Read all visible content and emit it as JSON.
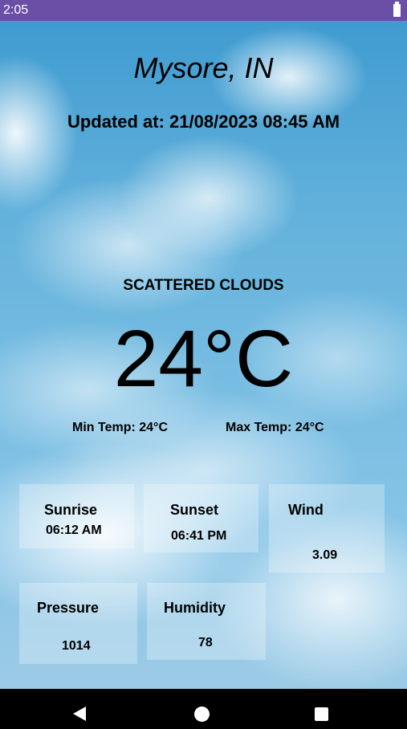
{
  "status_bar": {
    "time": "2:05",
    "battery_icon": "battery-full-icon"
  },
  "location": "Mysore, IN",
  "updated": "Updated at: 21/08/2023 08:45 AM",
  "weather": {
    "description": "SCATTERED CLOUDS",
    "temperature": "24°C",
    "min_temp": "Min Temp: 24°C",
    "max_temp": "Max Temp: 24°C"
  },
  "details": {
    "sunrise": {
      "label": "Sunrise",
      "value": "06:12 AM"
    },
    "sunset": {
      "label": "Sunset",
      "value": "06:41 PM"
    },
    "wind": {
      "label": "Wind",
      "value": "3.09"
    },
    "pressure": {
      "label": "Pressure",
      "value": "1014"
    },
    "humidity": {
      "label": "Humidity",
      "value": "78"
    }
  },
  "nav_bar": {
    "back_icon": "back-triangle-icon",
    "home_icon": "home-circle-icon",
    "recents_icon": "recents-square-icon"
  },
  "colors": {
    "status_bar": "#6b4fa7",
    "nav_bar": "#000000",
    "sky": "#64b2dc"
  }
}
